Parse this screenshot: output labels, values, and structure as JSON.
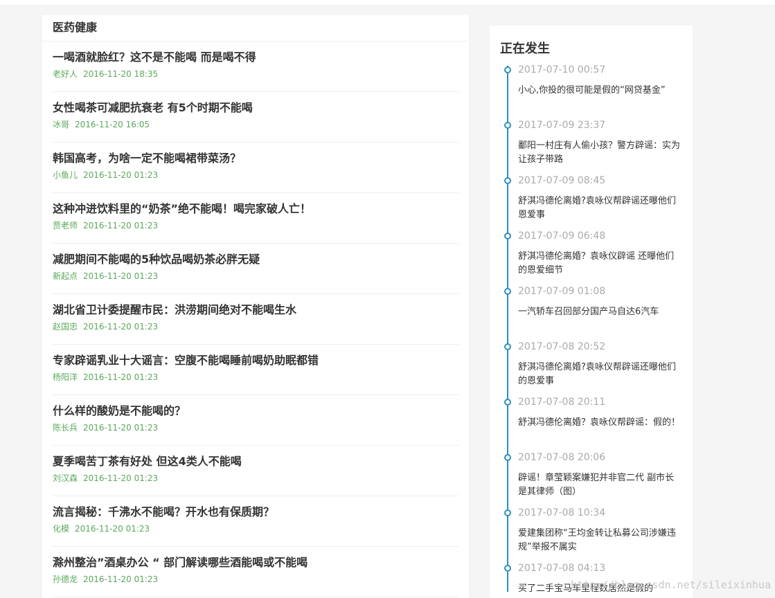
{
  "main": {
    "title": "医药健康",
    "articles": [
      {
        "title": "一喝酒就脸红？这不是不能喝 而是喝不得",
        "author": "老好人",
        "date": "2016-11-20 18:35"
      },
      {
        "title": "女性喝茶可减肥抗衰老 有5个时期不能喝",
        "author": "冰哥",
        "date": "2016-11-20 16:05"
      },
      {
        "title": "韩国高考，为啥一定不能喝裙带菜汤？",
        "author": "小鱼儿",
        "date": "2016-11-20 01:23"
      },
      {
        "title": "这种冲进饮料里的“奶茶”绝不能喝！喝完家破人亡！",
        "author": "贾老师",
        "date": "2016-11-20 01:23"
      },
      {
        "title": "减肥期间不能喝的5种饮品喝奶茶必胖无疑",
        "author": "新起点",
        "date": "2016-11-20 01:23"
      },
      {
        "title": "湖北省卫计委提醒市民：洪涝期间绝对不能喝生水",
        "author": "赵国忠",
        "date": "2016-11-20 01:23"
      },
      {
        "title": "专家辟谣乳业十大谣言：空腹不能喝睡前喝奶助眠都错",
        "author": "杨阳洋",
        "date": "2016-11-20 01:23"
      },
      {
        "title": "什么样的酸奶是不能喝的？",
        "author": "陈长兵",
        "date": "2016-11-20 01:23"
      },
      {
        "title": "夏季喝苦丁茶有好处 但这4类人不能喝",
        "author": "刘汉森",
        "date": "2016-11-20 01:23"
      },
      {
        "title": "流言揭秘：千沸水不能喝？开水也有保质期？",
        "author": "化模",
        "date": "2016-11-20 01:23"
      },
      {
        "title": "滁州整治”酒桌办公 “ 部门解读哪些酒能喝或不能喝",
        "author": "孙德龙",
        "date": "2016-11-20 01:23"
      }
    ]
  },
  "sidebar": {
    "title": "正在发生",
    "items": [
      {
        "time": "2017-07-10 00:57",
        "text": "小心,你投的很可能是假的“网贷基金”"
      },
      {
        "time": "2017-07-09 23:37",
        "text": "鄱阳一村庄有人偷小孩？警方辟谣：实为让孩子带路"
      },
      {
        "time": "2017-07-09 08:45",
        "text": "舒淇冯德伦离婚?袁咏仪帮辟谣还曝他们恩爱事"
      },
      {
        "time": "2017-07-09 06:48",
        "text": "舒淇冯德伦离婚？袁咏仪辟谣 还曝他们的恩爱细节"
      },
      {
        "time": "2017-07-09 01:08",
        "text": "一汽轿车召回部分国产马自达6汽车"
      },
      {
        "time": "2017-07-08 20:52",
        "text": "舒淇冯德伦离婚?袁咏仪帮辟谣还曝他们的恩爱事"
      },
      {
        "time": "2017-07-08 20:11",
        "text": "舒淇冯德伦离婚？袁咏仪帮辟谣：假的！"
      },
      {
        "time": "2017-07-08 20:06",
        "text": "辟谣！章莹颖案嫌犯并非官二代 副市长是其律师（图）"
      },
      {
        "time": "2017-07-08 10:34",
        "text": "爱建集团称“王均金转让私募公司涉嫌违规”举报不属实"
      },
      {
        "time": "2017-07-08 04:13",
        "text": "买了二手宝马车里程数居然是假的"
      }
    ]
  },
  "watermark": "http://blog.csdn.net/sileixinhua",
  "colors": {
    "accent": "#2d8fbf",
    "meta_green": "#5ba85b",
    "time_gray": "#aaaaaa"
  }
}
